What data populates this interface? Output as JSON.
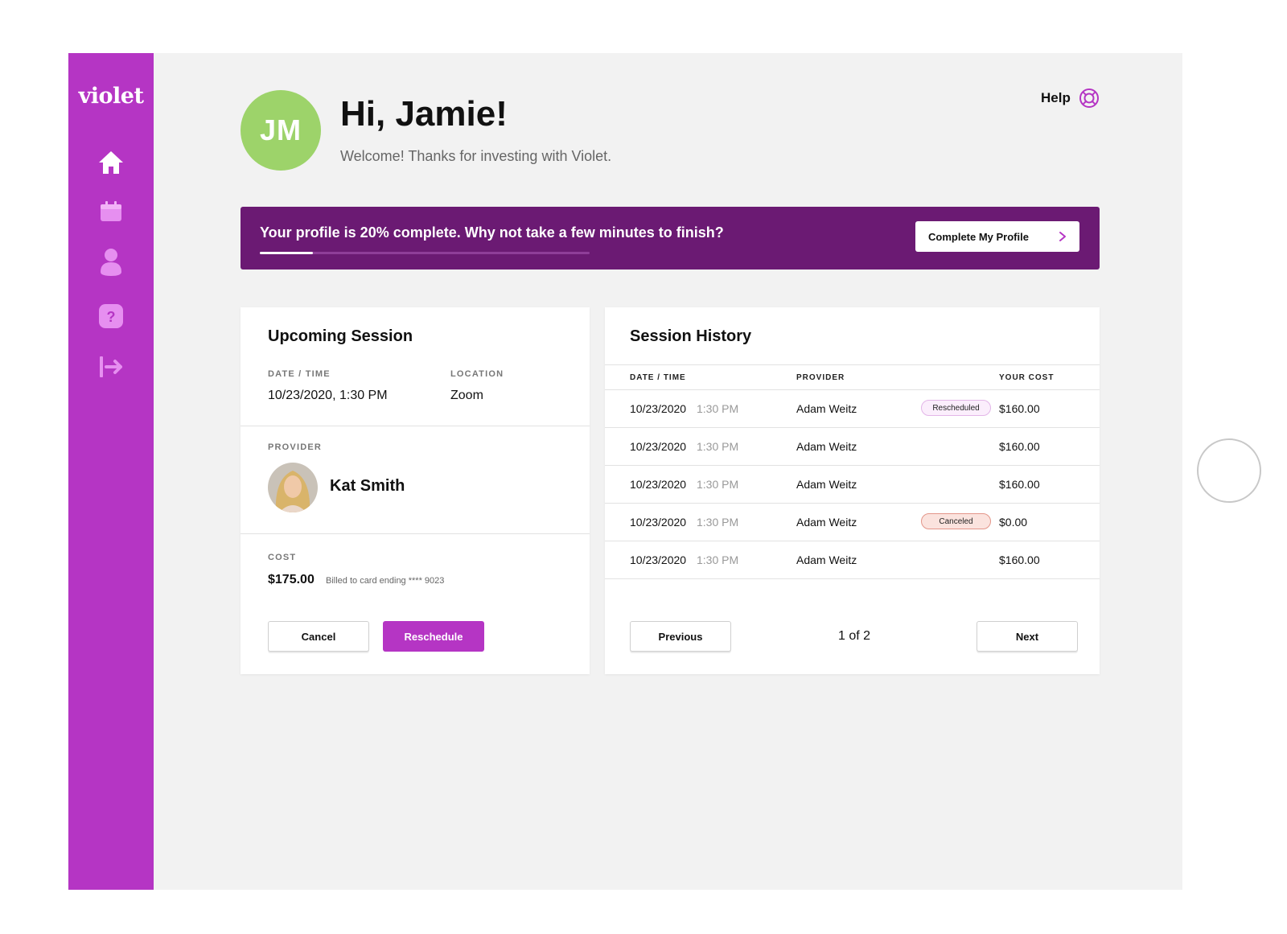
{
  "app": {
    "logo": "violet"
  },
  "sidebar": {
    "items": [
      {
        "id": "home",
        "icon": "home-icon"
      },
      {
        "id": "calendar",
        "icon": "calendar-icon"
      },
      {
        "id": "profile",
        "icon": "user-icon"
      },
      {
        "id": "support",
        "icon": "question-icon"
      },
      {
        "id": "logout",
        "icon": "logout-icon"
      }
    ]
  },
  "header": {
    "initials": "JM",
    "greeting": "Hi, Jamie!",
    "subtitle": "Welcome! Thanks for investing with Violet.",
    "help_label": "Help",
    "help_icon": "lifebuoy-icon"
  },
  "banner": {
    "text": "Your profile is 20% complete. Why not take a few minutes to finish?",
    "progress_percent": 20,
    "button_label": "Complete My Profile"
  },
  "upcoming": {
    "title": "Upcoming Session",
    "date_label": "DATE / TIME",
    "date_value": "10/23/2020, 1:30 PM",
    "location_label": "LOCATION",
    "location_value": "Zoom",
    "provider_label": "PROVIDER",
    "provider_name": "Kat Smith",
    "cost_label": "COST",
    "cost_value": "$175.00",
    "cost_note": "Billed to card ending **** 9023",
    "cancel_label": "Cancel",
    "reschedule_label": "Reschedule"
  },
  "history": {
    "title": "Session History",
    "columns": {
      "date": "DATE / TIME",
      "provider": "PROVIDER",
      "cost": "YOUR COST"
    },
    "rows": [
      {
        "date": "10/23/2020",
        "time": "1:30 PM",
        "provider": "Adam Weitz",
        "status": "Rescheduled",
        "cost": "$160.00"
      },
      {
        "date": "10/23/2020",
        "time": "1:30 PM",
        "provider": "Adam Weitz",
        "status": "",
        "cost": "$160.00"
      },
      {
        "date": "10/23/2020",
        "time": "1:30 PM",
        "provider": "Adam Weitz",
        "status": "",
        "cost": "$160.00"
      },
      {
        "date": "10/23/2020",
        "time": "1:30 PM",
        "provider": "Adam Weitz",
        "status": "Canceled",
        "cost": "$0.00"
      },
      {
        "date": "10/23/2020",
        "time": "1:30 PM",
        "provider": "Adam Weitz",
        "status": "",
        "cost": "$160.00"
      }
    ],
    "previous_label": "Previous",
    "page_indicator": "1 of 2",
    "next_label": "Next"
  },
  "colors": {
    "brand": "#b535c4",
    "banner": "#6b1a73",
    "avatar": "#9dd36a",
    "background": "#f2f2f2"
  }
}
